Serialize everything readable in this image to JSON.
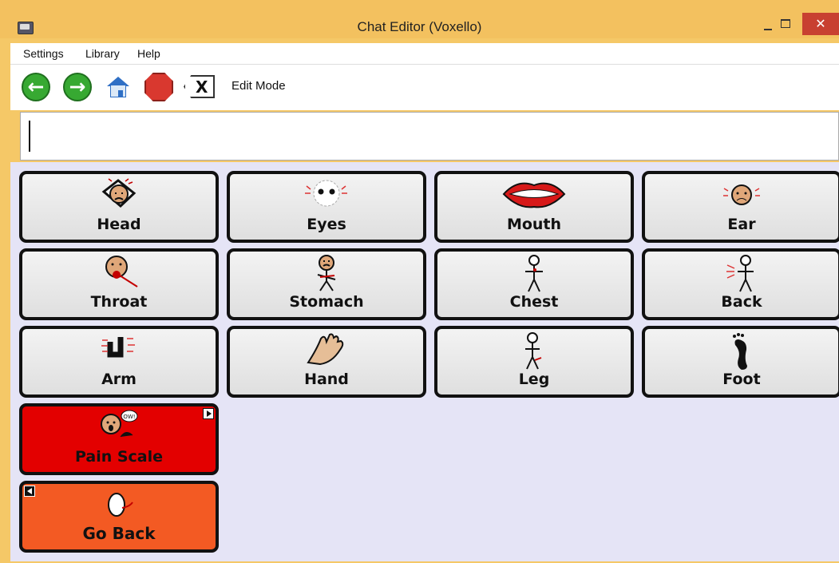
{
  "window": {
    "title": "Chat Editor (Voxello)",
    "close_symbol": "✕"
  },
  "menu": {
    "items": [
      "Settings",
      "Library",
      "Help"
    ]
  },
  "toolbar": {
    "back_symbol": "←",
    "forward_symbol": "→",
    "mode_label": "Edit Mode",
    "delete_symbol": "X"
  },
  "tiles": [
    {
      "label": "Head",
      "icon": "head-pain-icon"
    },
    {
      "label": "Eyes",
      "icon": "eyes-icon"
    },
    {
      "label": "Mouth",
      "icon": "mouth-icon"
    },
    {
      "label": "Ear",
      "icon": "ear-icon"
    },
    {
      "label": "Throat",
      "icon": "throat-icon"
    },
    {
      "label": "Stomach",
      "icon": "stomach-icon"
    },
    {
      "label": "Chest",
      "icon": "chest-icon"
    },
    {
      "label": "Back",
      "icon": "back-icon"
    },
    {
      "label": "Arm",
      "icon": "arm-icon"
    },
    {
      "label": "Hand",
      "icon": "hand-icon"
    },
    {
      "label": "Leg",
      "icon": "leg-icon"
    },
    {
      "label": "Foot",
      "icon": "foot-icon"
    }
  ],
  "special_tiles": {
    "pain_scale": "Pain Scale",
    "pain_speech": "OW!",
    "go_back": "Go Back"
  },
  "colors": {
    "title_bar": "#f3c15f",
    "board_background": "#e5e4f6",
    "pain_scale": "#e30000",
    "go_back": "#f35a23",
    "close_button": "#c84031"
  }
}
